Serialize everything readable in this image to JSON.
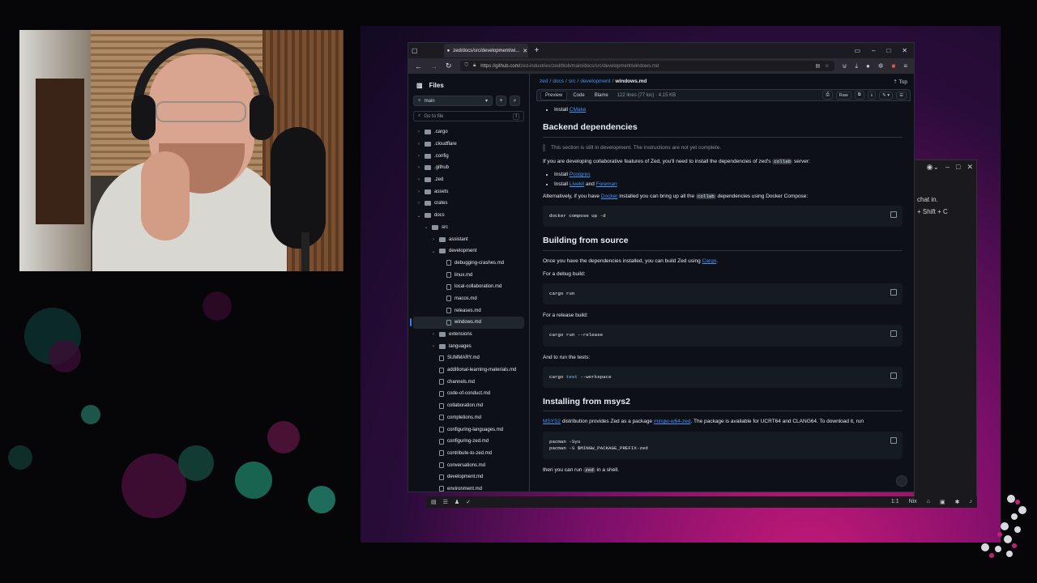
{
  "browser": {
    "tab_title": "zed/docs/src/development/wi...",
    "url_plain": "https://github.com/",
    "url_path": "zed-industries/zed/blob/main/docs/src/development/windows.md"
  },
  "sidebar": {
    "title": "Files",
    "branch": "main",
    "goto_placeholder": "Go to file",
    "goto_kbd": "t",
    "tree": [
      {
        "label": ".cargo",
        "kind": "folder",
        "depth": 0,
        "chev": "›"
      },
      {
        "label": ".cloudflare",
        "kind": "folder",
        "depth": 0,
        "chev": "›"
      },
      {
        "label": ".config",
        "kind": "folder",
        "depth": 0,
        "chev": "›"
      },
      {
        "label": ".github",
        "kind": "folder",
        "depth": 0,
        "chev": "›"
      },
      {
        "label": ".zed",
        "kind": "folder",
        "depth": 0,
        "chev": "›"
      },
      {
        "label": "assets",
        "kind": "folder",
        "depth": 0,
        "chev": "›"
      },
      {
        "label": "crates",
        "kind": "folder",
        "depth": 0,
        "chev": "›"
      },
      {
        "label": "docs",
        "kind": "folder",
        "depth": 0,
        "chev": "⌄"
      },
      {
        "label": "src",
        "kind": "folder",
        "depth": 1,
        "chev": "⌄"
      },
      {
        "label": "assistant",
        "kind": "folder",
        "depth": 2,
        "chev": "›"
      },
      {
        "label": "development",
        "kind": "folder",
        "depth": 2,
        "chev": "⌄"
      },
      {
        "label": "debugging-crashes.md",
        "kind": "file",
        "depth": 3,
        "chev": ""
      },
      {
        "label": "linux.md",
        "kind": "file",
        "depth": 3,
        "chev": ""
      },
      {
        "label": "local-collaboration.md",
        "kind": "file",
        "depth": 3,
        "chev": ""
      },
      {
        "label": "macos.md",
        "kind": "file",
        "depth": 3,
        "chev": ""
      },
      {
        "label": "releases.md",
        "kind": "file",
        "depth": 3,
        "chev": ""
      },
      {
        "label": "windows.md",
        "kind": "file",
        "depth": 3,
        "chev": "",
        "active": true
      },
      {
        "label": "extensions",
        "kind": "folder",
        "depth": 2,
        "chev": "›"
      },
      {
        "label": "languages",
        "kind": "folder",
        "depth": 2,
        "chev": "›"
      },
      {
        "label": "SUMMARY.md",
        "kind": "file",
        "depth": 2,
        "chev": ""
      },
      {
        "label": "additional-learning-materials.md",
        "kind": "file",
        "depth": 2,
        "chev": ""
      },
      {
        "label": "channels.md",
        "kind": "file",
        "depth": 2,
        "chev": ""
      },
      {
        "label": "code-of-conduct.md",
        "kind": "file",
        "depth": 2,
        "chev": ""
      },
      {
        "label": "collaboration.md",
        "kind": "file",
        "depth": 2,
        "chev": ""
      },
      {
        "label": "completions.md",
        "kind": "file",
        "depth": 2,
        "chev": ""
      },
      {
        "label": "configuring-languages.md",
        "kind": "file",
        "depth": 2,
        "chev": ""
      },
      {
        "label": "configuring-zed.md",
        "kind": "file",
        "depth": 2,
        "chev": ""
      },
      {
        "label": "contribute-to-zed.md",
        "kind": "file",
        "depth": 2,
        "chev": ""
      },
      {
        "label": "conversations.md",
        "kind": "file",
        "depth": 2,
        "chev": ""
      },
      {
        "label": "development.md",
        "kind": "file",
        "depth": 2,
        "chev": ""
      },
      {
        "label": "environment.md",
        "kind": "file",
        "depth": 2,
        "chev": ""
      }
    ]
  },
  "breadcrumb": {
    "parts": [
      "zed",
      "docs",
      "src",
      "development"
    ],
    "current": "windows.md",
    "top": "Top"
  },
  "toolbar": {
    "preview": "Preview",
    "code": "Code",
    "blame": "Blame",
    "meta": "122 lines (77 loc) · 4.15 KB",
    "raw": "Raw"
  },
  "doc": {
    "install": "Install",
    "cmake": "CMake",
    "h_backend": "Backend dependencies",
    "quote": "This section is still in development. The instructions are not yet complete.",
    "p_collab_a": "If you are developing collaborative features of Zed, you'll need to install the dependencies of zed's",
    "collab": "collab",
    "p_collab_b": "server:",
    "install2": "Install",
    "postgres": "Postgres",
    "install3": "Install",
    "livekit": "Livekit",
    "and": "and",
    "foreman": "Foreman",
    "p_alt_a": "Alternatively, if you have",
    "docker": "Docker",
    "p_alt_b": "installed you can bring up all the",
    "p_alt_c": "dependencies using Docker Compose:",
    "code_compose": "docker compose up -d",
    "h_build": "Building from source",
    "p_build_a": "Once you have the dependencies installed, you can build Zed using",
    "cargo": "Cargo",
    "p_debug": "For a debug build:",
    "code_debug": "cargo run",
    "p_release": "For a release build:",
    "code_release": "cargo run --release",
    "p_tests": "And to run the tests:",
    "code_test_a": "cargo",
    "code_test_kw": "test",
    "code_test_b": "--workspace",
    "h_msys": "Installing from msys2",
    "msys2": "MSYS2",
    "p_msys_a": "distribution provides Zed as a package",
    "mingw": "mingw-w64-zed",
    "p_msys_b": ". The package is available for UCRT64 and CLANG64. To download it, run",
    "code_pac1": "pacman -Syu",
    "code_pac2": "pacman -S $MINGW_PACKAGE_PREFIX-zed",
    "p_then_a": "then you can run",
    "zed": "zed",
    "p_then_b": "in a shell."
  },
  "bgwin": {
    "line1": "chat in.",
    "line2": "+ Shift + C"
  },
  "statusbar": {
    "pos": "1:1",
    "lang": "Nix"
  }
}
